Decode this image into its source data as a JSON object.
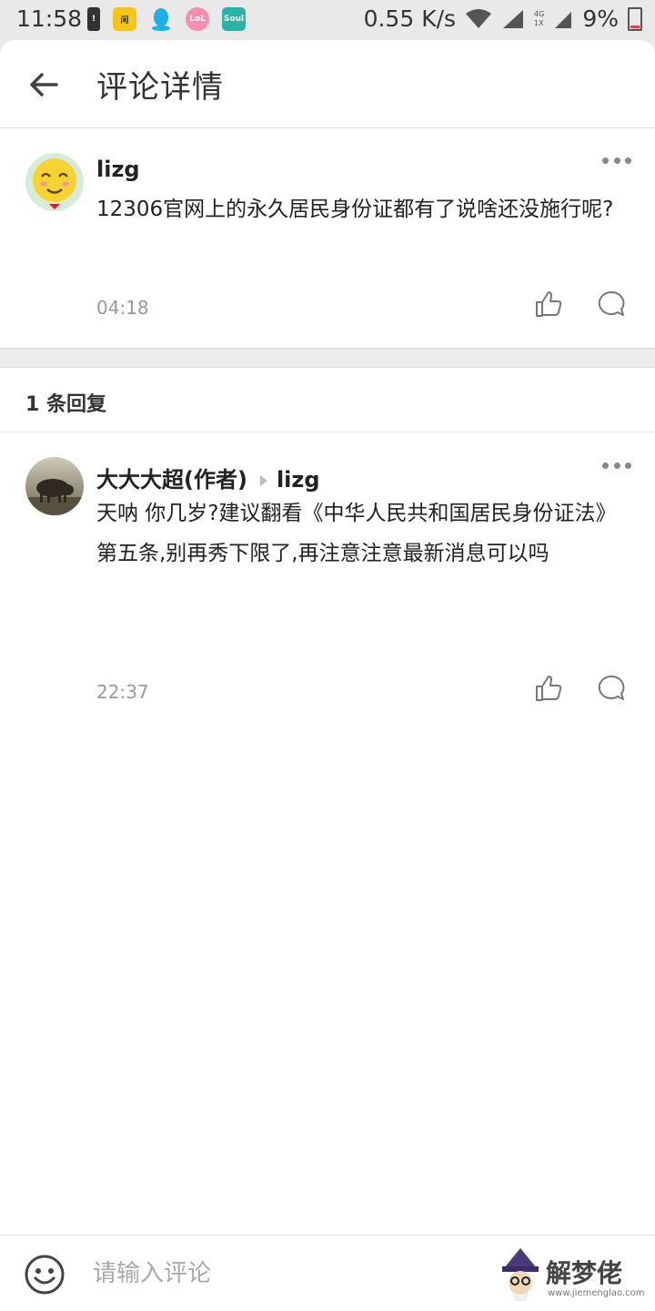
{
  "status_bar": {
    "time": "11:58",
    "network_speed": "0.55 K/s",
    "battery": "9%",
    "network_type": "4G",
    "sim_slot": "1X",
    "app_icons": [
      "alert-icon",
      "app-yellow-icon",
      "qq-icon",
      "lofter-icon",
      "soul-icon"
    ]
  },
  "header": {
    "title": "评论详情"
  },
  "main_comment": {
    "username": "lizg",
    "text": "12306官网上的永久居民身份证都有了说啥还没施行呢?",
    "time": "04:18"
  },
  "replies_section": {
    "count_label": "1 条回复"
  },
  "replies": [
    {
      "username": "大大大超(作者)",
      "reply_to": "lizg",
      "text": "天呐 你几岁?建议翻看《中华人民共和国居民身份证法》第五条,别再秀下限了,再注意注意最新消息可以吗",
      "time": "22:37"
    }
  ],
  "bottom_bar": {
    "placeholder": "请输入评论"
  },
  "watermark": {
    "text": "解梦佬",
    "url": "www.jiemenglao.com"
  },
  "colors": {
    "background": "#ffffff",
    "separator": "#ececec",
    "secondary_text": "#999999",
    "icon_gray": "#888888"
  }
}
